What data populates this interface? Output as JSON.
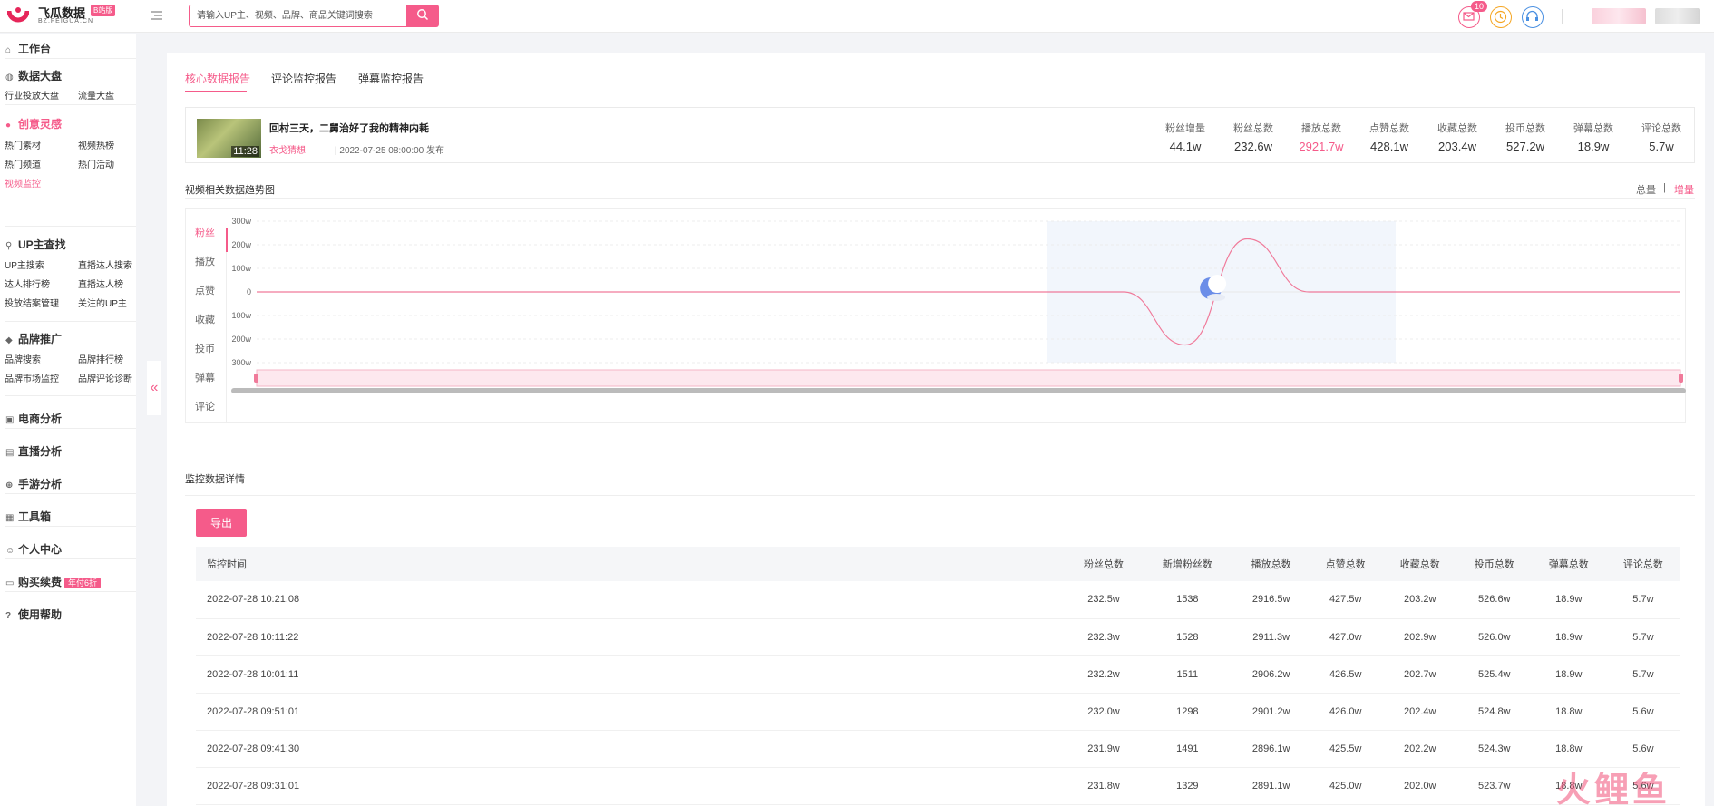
{
  "header": {
    "brand": "飞瓜数据",
    "brand_badge": "B站版",
    "brand_sub": "BZ.FEIGUA.CN",
    "search_placeholder": "请输入UP主、视频、品牌、商品关键词搜索",
    "mail_count": "10"
  },
  "sidebar": {
    "workspace": "工作台",
    "data_board": "数据大盘",
    "industry_board": "行业投放大盘",
    "traffic_board": "流量大盘",
    "creative": "创意灵感",
    "hot_material": "热门素材",
    "video_hot": "视频热榜",
    "hot_channel": "热门频道",
    "hot_event": "热门活动",
    "video_monitor": "视频监控",
    "up_search": "UP主查找",
    "up_search_link": "UP主搜索",
    "live_search": "直播达人搜索",
    "talent_rank": "达人排行榜",
    "live_rank": "直播达人榜",
    "ad_manage": "投放结案管理",
    "followed_up": "关注的UP主",
    "brand_promo": "品牌推广",
    "brand_search": "品牌搜索",
    "brand_rank": "品牌排行榜",
    "brand_market": "品牌市场监控",
    "brand_comment": "品牌评论诊断",
    "ecommerce": "电商分析",
    "live": "直播分析",
    "mobile_game": "手游分析",
    "toolbox": "工具箱",
    "personal": "个人中心",
    "buy": "购买续费",
    "buy_badge": "年付6折",
    "help": "使用帮助"
  },
  "tabs": [
    "核心数据报告",
    "评论监控报告",
    "弹幕监控报告"
  ],
  "video": {
    "title": "回村三天，二舅治好了我的精神内耗",
    "up": "衣戈猜想",
    "date": "| 2022-07-25 08:00:00 发布",
    "duration": "11:28",
    "stats": [
      {
        "label": "粉丝增量",
        "value": "44.1w"
      },
      {
        "label": "粉丝总数",
        "value": "232.6w"
      },
      {
        "label": "播放总数",
        "value": "2921.7w"
      },
      {
        "label": "点赞总数",
        "value": "428.1w"
      },
      {
        "label": "收藏总数",
        "value": "203.4w"
      },
      {
        "label": "投币总数",
        "value": "527.2w"
      },
      {
        "label": "弹幕总数",
        "value": "18.9w"
      },
      {
        "label": "评论总数",
        "value": "5.7w"
      }
    ]
  },
  "trend": {
    "title": "视频相关数据趋势图",
    "toggle_total": "总量",
    "toggle_sep": "|",
    "toggle_incr": "增量",
    "metrics": [
      "粉丝",
      "播放",
      "点赞",
      "收藏",
      "投币",
      "弹幕",
      "评论"
    ]
  },
  "chart_data": {
    "type": "line",
    "series": [
      {
        "name": "粉丝",
        "values": [
          0,
          0,
          0,
          0,
          0,
          0,
          0,
          0,
          0,
          0,
          0,
          0,
          0,
          0,
          0,
          -225,
          225,
          0,
          0,
          0,
          0,
          0,
          0,
          0
        ]
      }
    ],
    "y_ticks": [
      "300w",
      "200w",
      "100w",
      "0",
      "-100w",
      "-200w",
      "-300w"
    ],
    "ylim": [
      -300,
      300
    ],
    "grid": true,
    "highlight_range_fraction": [
      0.555,
      0.8
    ]
  },
  "monitor": {
    "title": "监控数据详情",
    "export": "导出",
    "columns": [
      "监控时间",
      "粉丝总数",
      "新增粉丝数",
      "播放总数",
      "点赞总数",
      "收藏总数",
      "投币总数",
      "弹幕总数",
      "评论总数"
    ],
    "rows": [
      [
        "2022-07-28 10:21:08",
        "232.5w",
        "1538",
        "2916.5w",
        "427.5w",
        "203.2w",
        "526.6w",
        "18.9w",
        "5.7w"
      ],
      [
        "2022-07-28 10:11:22",
        "232.3w",
        "1528",
        "2911.3w",
        "427.0w",
        "202.9w",
        "526.0w",
        "18.9w",
        "5.7w"
      ],
      [
        "2022-07-28 10:01:11",
        "232.2w",
        "1511",
        "2906.2w",
        "426.5w",
        "202.7w",
        "525.4w",
        "18.9w",
        "5.7w"
      ],
      [
        "2022-07-28 09:51:01",
        "232.0w",
        "1298",
        "2901.2w",
        "426.0w",
        "202.4w",
        "524.8w",
        "18.8w",
        "5.6w"
      ],
      [
        "2022-07-28 09:41:30",
        "231.9w",
        "1491",
        "2896.1w",
        "425.5w",
        "202.2w",
        "524.3w",
        "18.8w",
        "5.6w"
      ],
      [
        "2022-07-28 09:31:01",
        "231.8w",
        "1329",
        "2891.1w",
        "425.0w",
        "202.0w",
        "523.7w",
        "18.8w",
        "5.6w"
      ]
    ]
  },
  "watermark": "火鲤鱼"
}
